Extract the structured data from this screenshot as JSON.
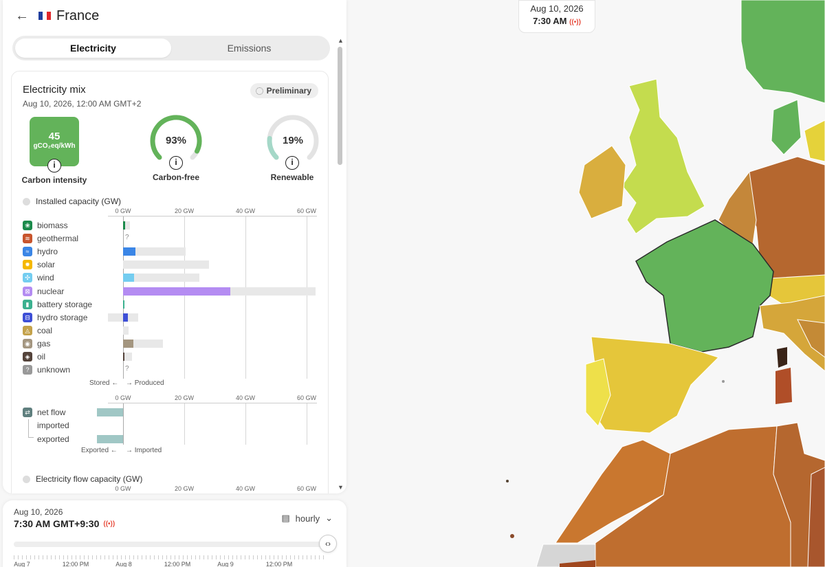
{
  "header": {
    "back_icon": "arrow-left-icon",
    "flag": [
      "#1f3e9e",
      "#ffffff",
      "#e0262b"
    ],
    "country": "France"
  },
  "tabs": [
    {
      "label": "Electricity",
      "active": true
    },
    {
      "label": "Emissions",
      "active": false
    }
  ],
  "mix": {
    "title": "Electricity mix",
    "date": "Aug 10, 2026, 12:00 AM GMT+2",
    "badge": "Preliminary",
    "carbon_intensity": {
      "value": "45",
      "unit": "gCO₂eq/kWh",
      "label": "Carbon intensity",
      "color": "#63b35a"
    },
    "carbon_free": {
      "percent": "93%",
      "fraction": 0.93,
      "label": "Carbon-free",
      "color": "#63b35a"
    },
    "renewable": {
      "percent": "19%",
      "fraction": 0.19,
      "label": "Renewable",
      "color": "#a5d8c8"
    }
  },
  "installed_capacity": {
    "label": "Installed capacity (GW)"
  },
  "axis_ticks": [
    "0 GW",
    "20 GW",
    "40 GW",
    "60 GW"
  ],
  "sources": [
    {
      "name": "biomass",
      "icon": "leaf-icon",
      "color": "#1b8a4b",
      "produced_gw": 0.7,
      "capacity_gw": 2.3,
      "glyph": "❀"
    },
    {
      "name": "geothermal",
      "icon": "heat-icon",
      "color": "#c8552d",
      "unknown": true,
      "glyph": "≋"
    },
    {
      "name": "hydro",
      "icon": "wave-icon",
      "color": "#3b86e6",
      "produced_gw": 4,
      "capacity_gw": 20.5,
      "glyph": "≈"
    },
    {
      "name": "solar",
      "icon": "sun-icon",
      "color": "#f5b800",
      "produced_gw": 0,
      "capacity_gw": 28,
      "glyph": "✹"
    },
    {
      "name": "wind",
      "icon": "wind-icon",
      "color": "#74cdf0",
      "produced_gw": 3.6,
      "capacity_gw": 25,
      "glyph": "✣"
    },
    {
      "name": "nuclear",
      "icon": "atom-icon",
      "color": "#b48cf2",
      "produced_gw": 35,
      "capacity_gw": 63,
      "glyph": "⊠"
    },
    {
      "name": "battery storage",
      "icon": "battery-icon",
      "color": "#3bb18f",
      "produced_gw": 0.3,
      "capacity_gw": 0.3,
      "glyph": "▮"
    },
    {
      "name": "hydro storage",
      "icon": "dam-icon",
      "color": "#3e4fd6",
      "produced_gw": 1.6,
      "capacity_gw": 5,
      "stored_gw": 5,
      "glyph": "⊟"
    },
    {
      "name": "coal",
      "icon": "coal-icon",
      "color": "#c4a24b",
      "produced_gw": 0,
      "capacity_gw": 1.8,
      "glyph": "◬"
    },
    {
      "name": "gas",
      "icon": "gas-icon",
      "color": "#a49680",
      "produced_gw": 3.4,
      "capacity_gw": 13,
      "glyph": "◉"
    },
    {
      "name": "oil",
      "icon": "oil-drop-icon",
      "color": "#54433a",
      "produced_gw": 0.3,
      "capacity_gw": 3,
      "glyph": "◈"
    },
    {
      "name": "unknown",
      "icon": "question-icon",
      "color": "#999999",
      "unknown": true,
      "glyph": "?"
    }
  ],
  "prod_legend": {
    "stored": "Stored ←",
    "produced": "→ Produced"
  },
  "exchange": {
    "net_flow_label": "net flow",
    "imported_label": "imported",
    "exported_label": "exported",
    "net_flow_gw": -8.6,
    "exported_gw": -8.6,
    "color": "#a0c7c5",
    "legend": {
      "exported": "Exported ←",
      "imported": "→ Imported"
    }
  },
  "flow_capacity": {
    "label": "Electricity flow capacity (GW)"
  },
  "timeline": {
    "date": "Aug 10, 2026",
    "time": "7:30 AM GMT+9:30",
    "live_icon": "broadcast-icon",
    "granularity": "hourly",
    "granularity_icon": "calendar-icon",
    "handle_icon": "code-brackets-icon",
    "ticks": [
      "Aug 7",
      "12:00 PM",
      "Aug 8",
      "12:00 PM",
      "Aug 9",
      "12:00 PM"
    ]
  },
  "map_badge": {
    "date": "Aug 10, 2026",
    "time": "7:30 AM"
  }
}
